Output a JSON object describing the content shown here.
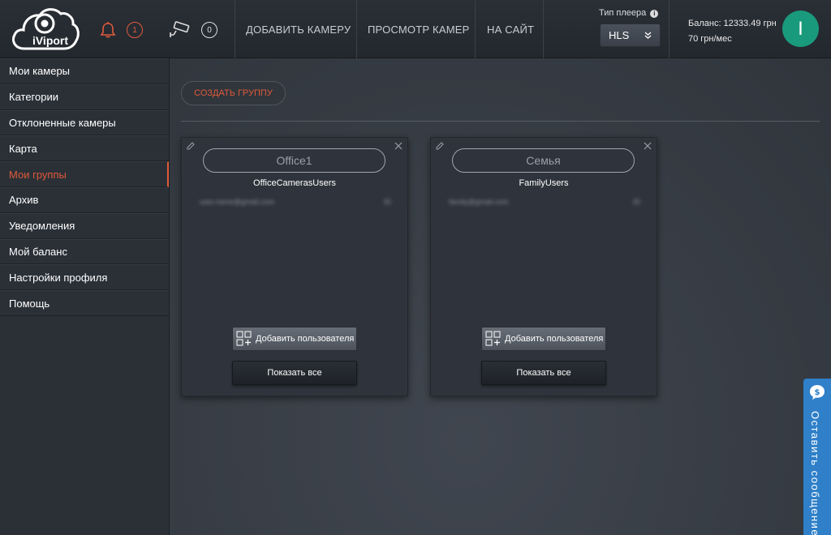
{
  "header": {
    "logo_text": "iViport",
    "alerts_count": "1",
    "cameras_count": "0",
    "nav": [
      {
        "label": "ДОБАВИТЬ КАМЕРУ"
      },
      {
        "label": "ПРОСМОТР КАМЕР"
      },
      {
        "label": "НА САЙТ"
      }
    ],
    "player_label": "Тип плеера",
    "player_value": "HLS",
    "balance_line": "Баланс: 12333.49 грн",
    "rate_line": "70 грн/мес",
    "avatar_initial": "I"
  },
  "sidebar": {
    "items": [
      {
        "label": "Мои камеры"
      },
      {
        "label": "Категории"
      },
      {
        "label": "Отклоненные камеры"
      },
      {
        "label": "Карта"
      },
      {
        "label": "Мои группы",
        "active": true
      },
      {
        "label": "Архив"
      },
      {
        "label": "Уведомления"
      },
      {
        "label": "Мой баланс"
      },
      {
        "label": "Настройки профиля"
      },
      {
        "label": "Помощь"
      }
    ]
  },
  "main": {
    "create_group_label": "СОЗДАТЬ ГРУППУ",
    "groups": [
      {
        "name": "Office1",
        "group_label": "OfficeCamerasUsers",
        "member_email": "user.name@gmail.com",
        "member_mark": "ID",
        "add_user_label": "Добавить пользователя",
        "show_all_label": "Показать все"
      },
      {
        "name": "Семья",
        "group_label": "FamilyUsers",
        "member_email": "family@gmail.com",
        "member_mark": "ID",
        "add_user_label": "Добавить пользователя",
        "show_all_label": "Показать все"
      }
    ]
  },
  "feedback": {
    "label": "Оставить сообщение"
  },
  "colors": {
    "accent": "#e05a3a",
    "avatar": "#1a9a7c",
    "feedback": "#2f80c9"
  }
}
